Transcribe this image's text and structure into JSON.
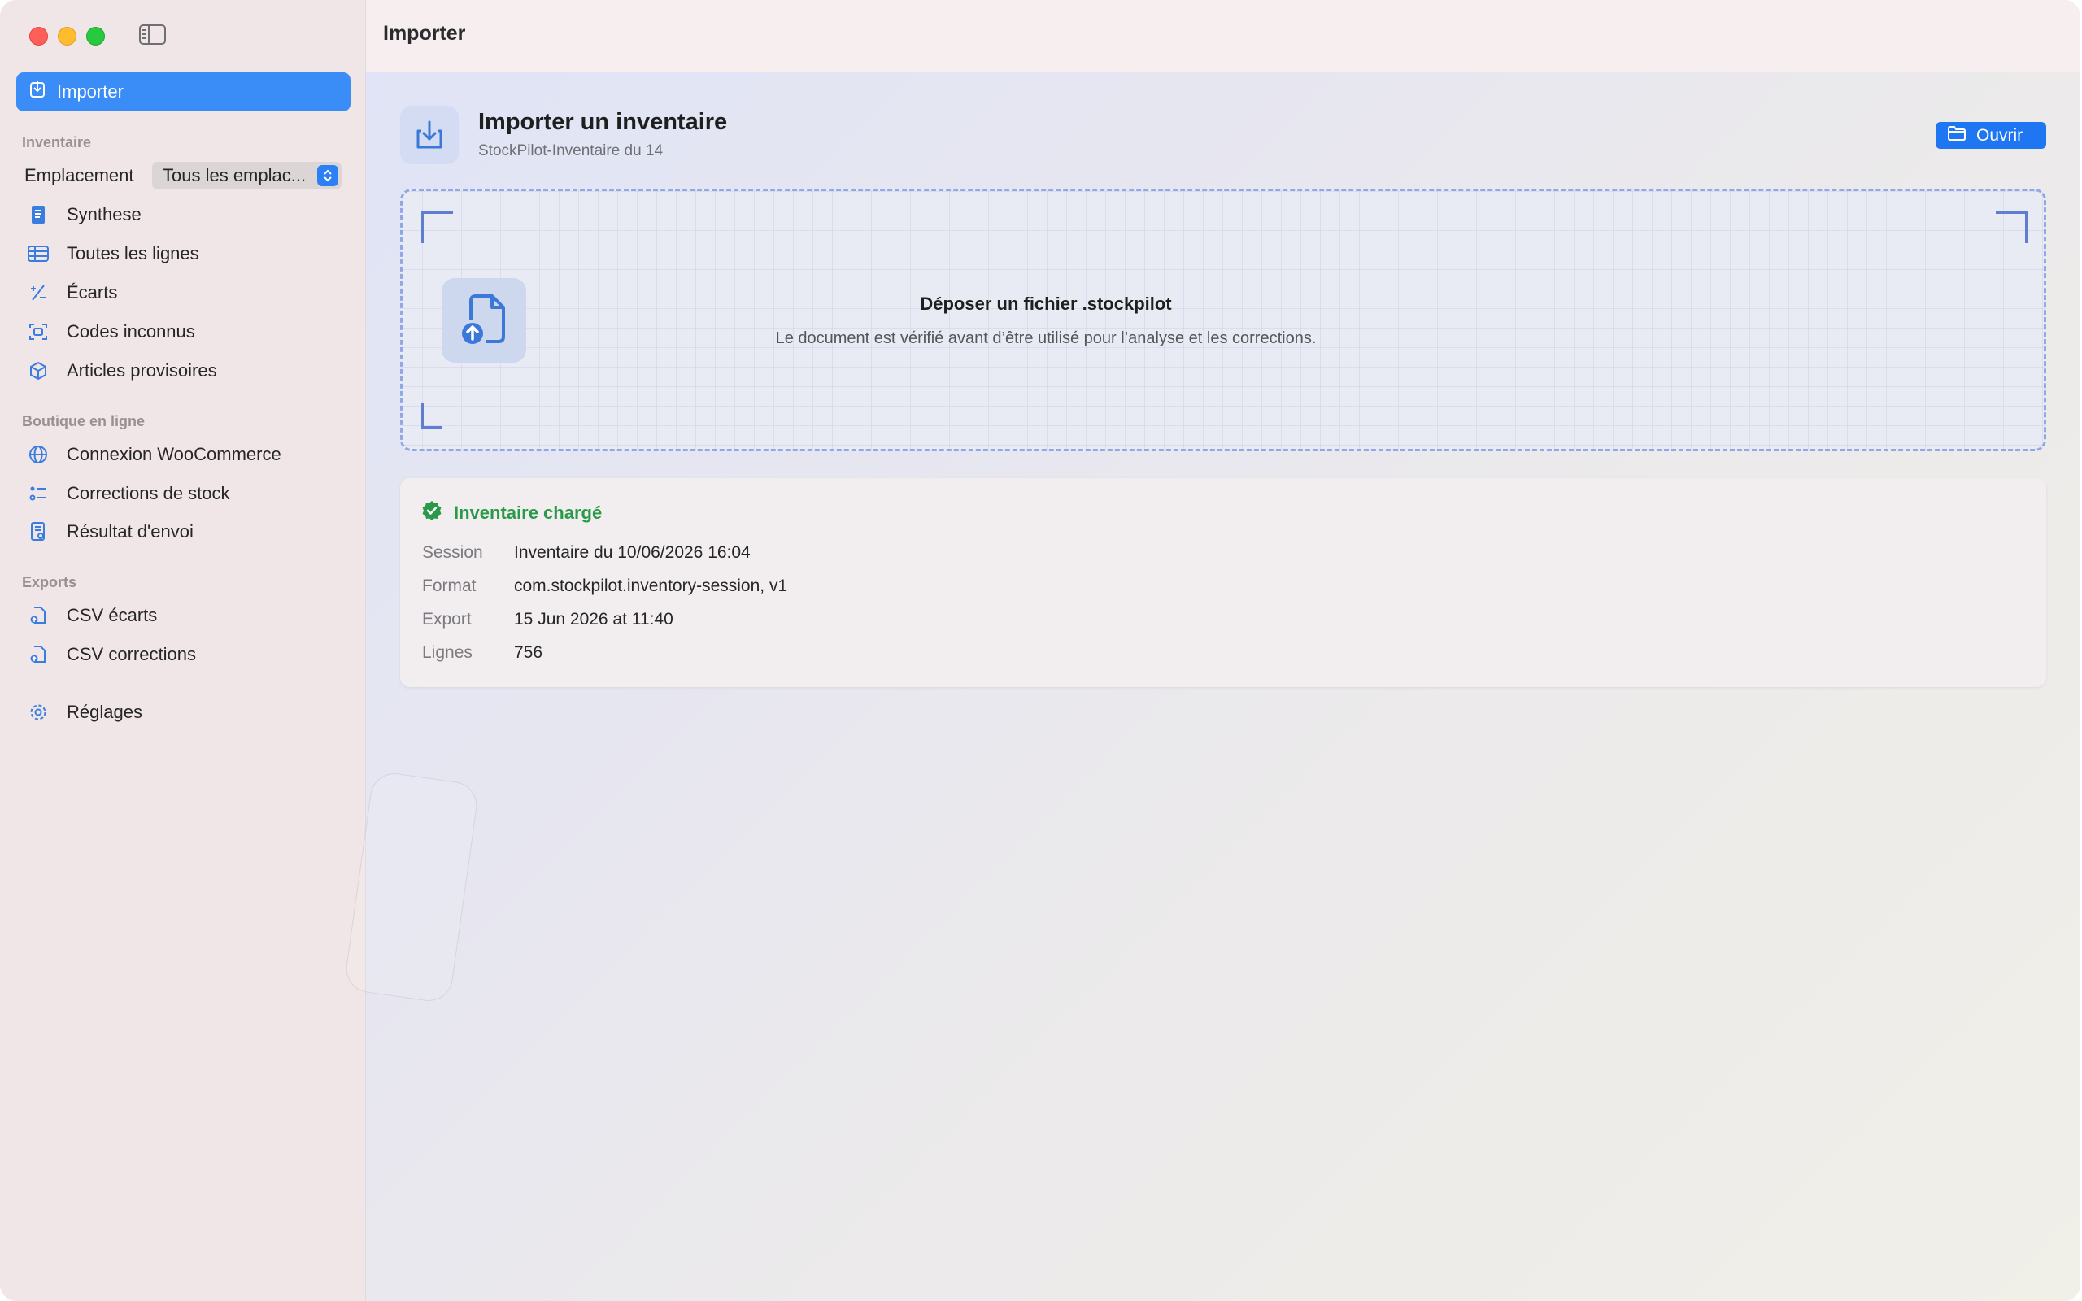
{
  "window": {
    "title": "Importer"
  },
  "sidebar": {
    "selected": {
      "label": "Importer",
      "icon": "import-icon"
    },
    "inventory_section": "Inventaire",
    "location": {
      "label": "Emplacement",
      "value": "Tous les emplac..."
    },
    "inventory_items": [
      {
        "label": "Synthese",
        "icon": "document-icon"
      },
      {
        "label": "Toutes les lignes",
        "icon": "table-icon"
      },
      {
        "label": "Écarts",
        "icon": "plus-minus-icon"
      },
      {
        "label": "Codes inconnus",
        "icon": "barcode-scan-icon"
      },
      {
        "label": "Articles provisoires",
        "icon": "box-icon"
      }
    ],
    "shop_section": "Boutique en ligne",
    "shop_items": [
      {
        "label": "Connexion WooCommerce",
        "icon": "globe-icon"
      },
      {
        "label": "Corrections de stock",
        "icon": "list-icon"
      },
      {
        "label": "Résultat d'envoi",
        "icon": "report-icon"
      }
    ],
    "exports_section": "Exports",
    "export_items": [
      {
        "label": "CSV écarts",
        "icon": "file-export-icon"
      },
      {
        "label": "CSV corrections",
        "icon": "file-export-icon"
      }
    ],
    "settings": {
      "label": "Réglages",
      "icon": "gear-icon"
    }
  },
  "main": {
    "header": {
      "title": "Importer un inventaire",
      "subtitle": "StockPilot-Inventaire du 14",
      "open_button": "Ouvrir"
    },
    "dropzone": {
      "title": "Déposer un fichier .stockpilot",
      "description": "Le document est vérifié avant d’être utilisé pour l’analyse et les corrections."
    },
    "status_card": {
      "status": "Inventaire chargé",
      "status_color": "#2a9a4a",
      "fields": [
        {
          "label": "Session",
          "value": "Inventaire du 10/06/2026 16:04"
        },
        {
          "label": "Format",
          "value": "com.stockpilot.inventory-session, v1"
        },
        {
          "label": "Export",
          "value": "15 Jun 2026 at 11:40"
        },
        {
          "label": "Lignes",
          "value": "756"
        }
      ]
    }
  },
  "colors": {
    "accent": "#3a8cf7",
    "sidebar_bg": "#f0e6e7",
    "success": "#2a9a4a"
  }
}
